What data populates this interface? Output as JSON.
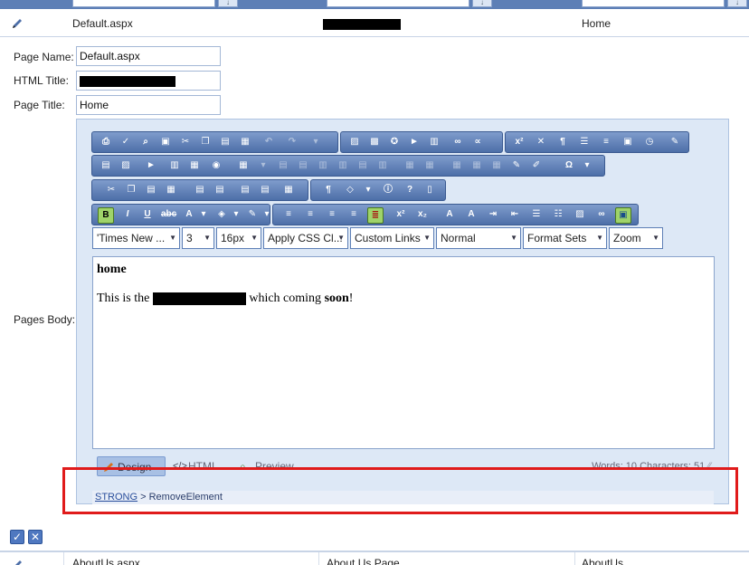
{
  "grid": {
    "selected_row": {
      "page_name": "Default.aspx",
      "html_title_redacted": true,
      "page_title": "Home"
    },
    "next_row": {
      "page_name": "AboutUs.aspx",
      "html_title": "About Us Page",
      "page_title": "AboutUs"
    }
  },
  "form": {
    "page_name_label": "Page Name:",
    "page_name_value": "Default.aspx",
    "html_title_label": "HTML Title:",
    "page_title_label": "Page Title:",
    "page_title_value": "Home",
    "pages_body_label": "Pages Body:"
  },
  "editor": {
    "combos": {
      "font_name": "'Times New ...",
      "font_size": "3",
      "real_font_size": "16px",
      "css_class": "Apply CSS Cl...",
      "custom_links": "Custom Links",
      "paragraph": "Normal",
      "format_sets": "Format Sets",
      "zoom": "Zoom"
    },
    "content": {
      "heading": "home",
      "line_prefix": "This is the",
      "line_middle": "which coming",
      "line_bold": "soon",
      "line_suffix": "!"
    },
    "modes": {
      "design": "Design",
      "html": "HTML",
      "preview": "Preview"
    },
    "stats": "Words: 10   Characters: 51",
    "path": {
      "element": "STRONG",
      "separator": " > ",
      "action": "RemoveElement"
    }
  },
  "colors": {
    "header_blue": "#5d7fb6",
    "highlight_red": "#e01b1b",
    "editor_bg": "#dde8f6"
  }
}
